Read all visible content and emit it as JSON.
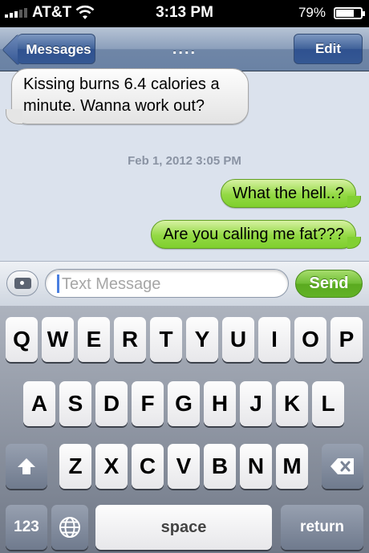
{
  "status_bar": {
    "carrier": "AT&T",
    "time": "3:13 PM",
    "battery_percent": "79%",
    "battery_level": 0.79,
    "icons": [
      "signal-icon",
      "wifi-icon",
      "battery-icon"
    ]
  },
  "nav": {
    "back_label": "Messages",
    "title": "....",
    "edit_label": "Edit"
  },
  "conversation": {
    "incoming": "Kissing burns 6.4 calories a minute.  Wanna work out?",
    "timestamp": "Feb 1, 2012 3:05 PM",
    "outgoing": [
      "What the hell..?",
      "Are you calling me fat???"
    ]
  },
  "composer": {
    "placeholder": "Text Message",
    "value": "",
    "send_label": "Send"
  },
  "keyboard": {
    "row1": [
      "Q",
      "W",
      "E",
      "R",
      "T",
      "Y",
      "U",
      "I",
      "O",
      "P"
    ],
    "row2": [
      "A",
      "S",
      "D",
      "F",
      "G",
      "H",
      "J",
      "K",
      "L"
    ],
    "row3": [
      "Z",
      "X",
      "C",
      "V",
      "B",
      "N",
      "M"
    ],
    "numbers_label": "123",
    "space_label": "space",
    "return_label": "return"
  },
  "colors": {
    "incoming_bubble": "#f3f3f3",
    "outgoing_bubble": "#8fd640",
    "nav_bar": "#7e93b2",
    "send_button": "#66b42a"
  }
}
